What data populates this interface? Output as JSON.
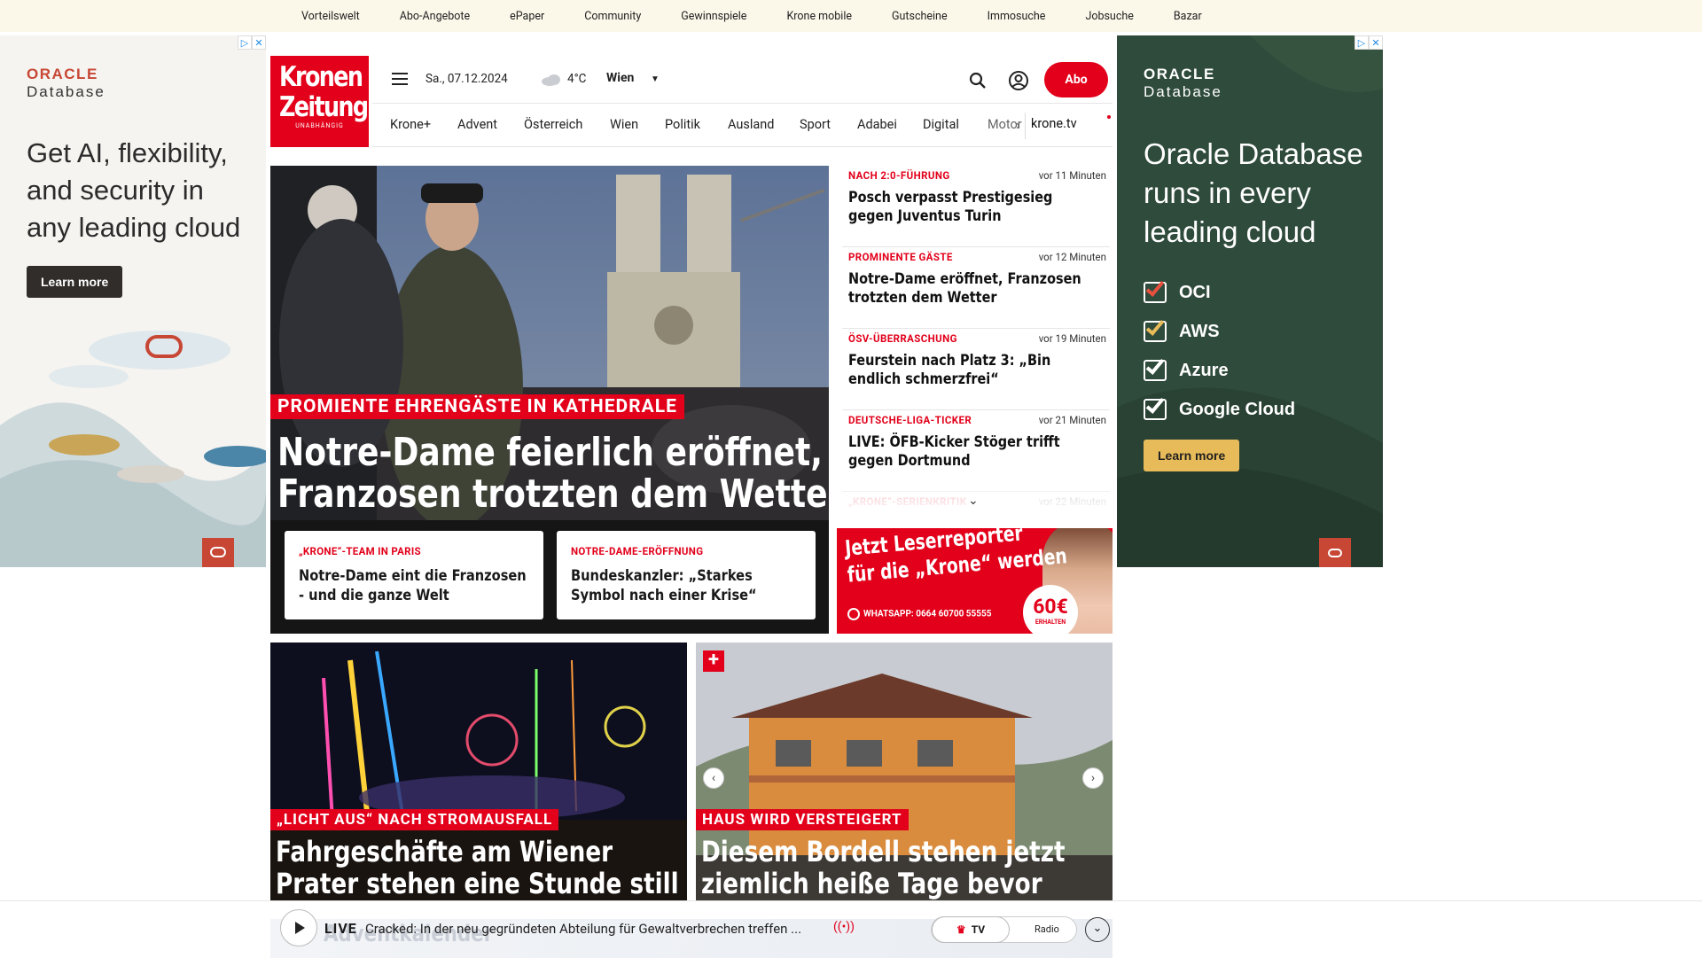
{
  "topbar": {
    "links": [
      "Vorteilswelt",
      "Abo-Angebote",
      "ePaper",
      "Community",
      "Gewinnspiele",
      "Krone mobile",
      "Gutscheine",
      "Immosuche",
      "Jobsuche",
      "Bazar"
    ]
  },
  "ad_left": {
    "brand_top": "ORACLE",
    "brand_bottom": "Database",
    "headline": "Get AI, flexibility, and security in any leading cloud",
    "cta": "Learn more"
  },
  "ad_right": {
    "brand_top": "ORACLE",
    "brand_bottom": "Database",
    "headline": "Oracle Database runs in every leading cloud",
    "checks": [
      "OCI",
      "AWS",
      "Azure",
      "Google Cloud"
    ],
    "cta": "Learn more"
  },
  "logo": {
    "line1": "Kronen",
    "line2": "Zeitung",
    "line3": "UNABHÄNGIG"
  },
  "header": {
    "date": "Sa., 07.12.2024",
    "temperature": "4°C",
    "location": "Wien",
    "abo_label": "Abo"
  },
  "nav": {
    "items": [
      "Krone+",
      "Advent",
      "Österreich",
      "Wien",
      "Politik",
      "Ausland",
      "Sport",
      "Adabei",
      "Digital",
      "Motor"
    ],
    "tv_link": "krone.tv"
  },
  "hero": {
    "kicker": "PROMIENTE EHRENGÄSTE IN KATHEDRALE",
    "title_line1": "Notre-Dame feierlich eröffnet,",
    "title_line2": "Franzosen trotzten dem Wetter",
    "subcards": [
      {
        "kicker": "„KRONE“-TEAM IN PARIS",
        "title_line1": "Notre-Dame eint die Franzosen",
        "title_line2": "- und die ganze Welt"
      },
      {
        "kicker": "NOTRE-DAME-ERÖFFNUNG",
        "title_line1": "Bundeskanzler: „Starkes",
        "title_line2": "Symbol nach einer Krise“"
      }
    ]
  },
  "news": [
    {
      "kicker": "NACH 2:0-FÜHRUNG",
      "time": "vor 11 Minuten",
      "title_line1": "Posch verpasst Prestigesieg",
      "title_line2": "gegen Juventus Turin"
    },
    {
      "kicker": "PROMINENTE GÄSTE",
      "time": "vor 12 Minuten",
      "title_line1": "Notre-Dame eröffnet, Franzosen",
      "title_line2": "trotzten dem Wetter"
    },
    {
      "kicker": "ÖSV-ÜBERRASCHUNG",
      "time": "vor 19 Minuten",
      "title_line1": "Feurstein nach Platz 3: „Bin",
      "title_line2": "endlich schmerzfrei“"
    },
    {
      "kicker": "DEUTSCHE-LIGA-TICKER",
      "time": "vor 21 Minuten",
      "title_line1": "LIVE: ÖFB-Kicker Stöger trifft",
      "title_line2": "gegen Dortmund"
    },
    {
      "kicker": "„KRONE“-SERIENKRITIK",
      "time": "vor 22 Minuten",
      "title_line1": "",
      "title_line2": ""
    }
  ],
  "leserreporter": {
    "line1": "Jetzt Leserreporter",
    "line2": "für die „Krone“ werden",
    "whatsapp": "WHATSAPP: 0664 60700 55555",
    "amount": "60€",
    "amount_sub": "ERHALTEN"
  },
  "tiles": [
    {
      "kicker": "„LICHT AUS“ NACH STROMAUSFALL",
      "title_line1": "Fahrgeschäfte am Wiener",
      "title_line2": "Prater stehen eine Stunde still"
    },
    {
      "kicker": "HAUS WIRD VERSTEIGERT",
      "title_line1": "Diesem Bordell stehen jetzt",
      "title_line2": "ziemlich heiße Tage bevor"
    }
  ],
  "player": {
    "live_label": "LIVE",
    "ticker": "Cracked: In der neu gegründeten Abteilung für Gewaltverbrechen treffen ...",
    "tv_label": "TV",
    "radio_label": "Radio",
    "background_text": "Adventkalender"
  },
  "colors": {
    "brand_red": "#e2001a",
    "oracle_red": "#c74634",
    "oracle_green": "#2f4b3c",
    "topbar_bg": "#fbf8ea"
  }
}
